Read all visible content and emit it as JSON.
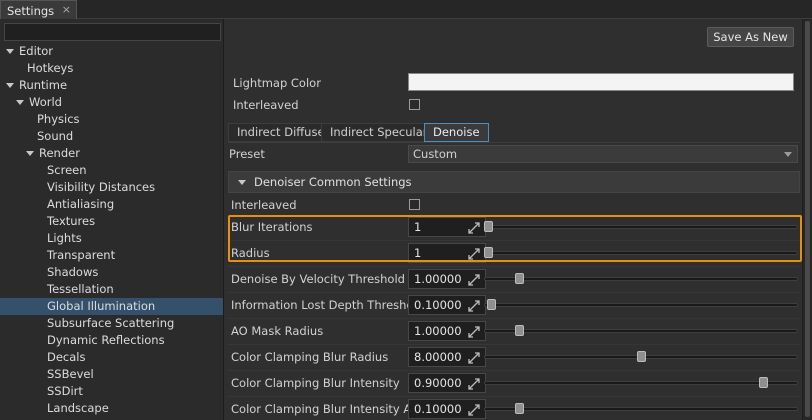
{
  "window": {
    "tab_title": "Settings",
    "close_glyph": "×"
  },
  "tree": [
    {
      "label": "Editor",
      "level": 0,
      "expanded": true
    },
    {
      "label": "Hotkeys",
      "level": 1
    },
    {
      "label": "Runtime",
      "level": 0,
      "expanded": true
    },
    {
      "label": "World",
      "level": 1,
      "expanded": true
    },
    {
      "label": "Physics",
      "level": 2
    },
    {
      "label": "Sound",
      "level": 2
    },
    {
      "label": "Render",
      "level": 2,
      "expanded": true
    },
    {
      "label": "Screen",
      "level": 3
    },
    {
      "label": "Visibility Distances",
      "level": 3
    },
    {
      "label": "Antialiasing",
      "level": 3
    },
    {
      "label": "Textures",
      "level": 3
    },
    {
      "label": "Lights",
      "level": 3
    },
    {
      "label": "Transparent",
      "level": 3
    },
    {
      "label": "Shadows",
      "level": 3
    },
    {
      "label": "Tessellation",
      "level": 3
    },
    {
      "label": "Global Illumination",
      "level": 3,
      "selected": true
    },
    {
      "label": "Subsurface Scattering",
      "level": 3
    },
    {
      "label": "Dynamic Reflections",
      "level": 3
    },
    {
      "label": "Decals",
      "level": 3
    },
    {
      "label": "SSBevel",
      "level": 3
    },
    {
      "label": "SSDirt",
      "level": 3
    },
    {
      "label": "Landscape",
      "level": 3
    }
  ],
  "toolbar": {
    "save_as_new": "Save As New"
  },
  "lightmap_color_label": "Lightmap Color",
  "interleaved_label": "Interleaved",
  "sub_tabs": [
    "Indirect Diffuse",
    "Indirect Specular",
    "Denoise"
  ],
  "active_sub_tab": 2,
  "preset": {
    "label": "Preset",
    "value": "Custom"
  },
  "group_title": "Denoiser Common Settings",
  "denoise_interleaved_label": "Interleaved",
  "params": [
    {
      "label": "Blur Iterations",
      "value": "1",
      "fraction": 0.0
    },
    {
      "label": "Radius",
      "value": "1",
      "fraction": 0.0
    },
    {
      "label": "Denoise By Velocity Threshold",
      "value": "1.00000",
      "fraction": 0.1
    },
    {
      "label": "Information Lost Depth Threshold",
      "value": "0.10000",
      "fraction": 0.01
    },
    {
      "label": "AO Mask Radius",
      "value": "1.00000",
      "fraction": 0.1
    },
    {
      "label": "Color Clamping Blur Radius",
      "value": "8.00000",
      "fraction": 0.5
    },
    {
      "label": "Color Clamping Blur Intensity",
      "value": "0.90000",
      "fraction": 0.9
    },
    {
      "label": "Color Clamping Blur Intensity AO",
      "value": "0.10000",
      "fraction": 0.1
    }
  ],
  "colors": {
    "highlight": "#e8900d",
    "selection": "#34506b",
    "active_tab_border": "#4f8cc2"
  }
}
